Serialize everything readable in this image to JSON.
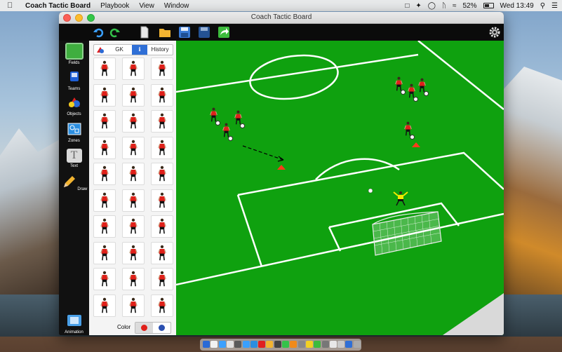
{
  "menubar": {
    "app_name": "Coach Tactic Board",
    "menus": [
      "Playbook",
      "View",
      "Window"
    ],
    "battery": "52%",
    "clock": "Wed 13:49"
  },
  "window": {
    "title": "Coach Tactic Board"
  },
  "sidebar": {
    "items": [
      {
        "label": "Fields",
        "icon": "field-icon"
      },
      {
        "label": "Teams",
        "icon": "teams-icon"
      },
      {
        "label": "Objects",
        "icon": "objects-icon"
      },
      {
        "label": "Zones",
        "icon": "zones-icon"
      },
      {
        "label": "Text",
        "icon": "text-icon"
      },
      {
        "label": "Draw",
        "icon": "pencil-icon"
      }
    ],
    "animation_label": "Animation"
  },
  "panel": {
    "tabs": [
      {
        "label": "GK"
      },
      {
        "label": "History"
      }
    ],
    "color_label": "Color",
    "colors": {
      "red": "#e0201a",
      "blue": "#2a4fb0"
    }
  },
  "colors": {
    "pitch": "#0fa10f",
    "player_shirt": "#e0201a",
    "gk_shirt": "#f2e800",
    "toolbar": "#0b0b0b"
  }
}
